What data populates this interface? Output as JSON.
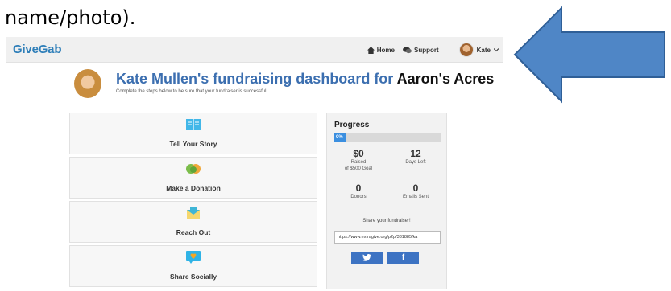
{
  "caption": "name/photo).",
  "navbar": {
    "brand": "GiveGab",
    "links": [
      {
        "label": "Home",
        "icon": "home-icon"
      },
      {
        "label": "Support",
        "icon": "chat-icon"
      }
    ],
    "user": {
      "name": "Kate",
      "icon": "chevron-down-icon"
    }
  },
  "dashboard": {
    "title_prefix": "Kate Mullen's fundraising dashboard for",
    "org_name": "Aaron's Acres",
    "subtitle": "Complete the steps below to be sure that your fundraiser is successful."
  },
  "steps": [
    {
      "label": "Tell Your Story",
      "icon": "book-icon"
    },
    {
      "label": "Make a Donation",
      "icon": "donation-icon"
    },
    {
      "label": "Reach Out",
      "icon": "envelope-icon"
    },
    {
      "label": "Share Socially",
      "icon": "heart-speech-icon"
    }
  ],
  "progress": {
    "title": "Progress",
    "percent_label": "0%",
    "percent_value": 0,
    "stats": [
      {
        "value": "$0",
        "label": "Raised",
        "label2": "of $500 Goal"
      },
      {
        "value": "12",
        "label": "Days Left"
      },
      {
        "value": "0",
        "label": "Donors"
      },
      {
        "value": "0",
        "label": "Emails Sent"
      }
    ],
    "share_label": "Share your fundraiser!",
    "share_url": "https://www.extragive.org/p2p/331885/ka",
    "twitter_label": "v",
    "facebook_label": "f"
  },
  "colors": {
    "brand": "#2f7fb9",
    "title": "#3c6fb0",
    "progress_fill": "#3b8fe0",
    "social": "#3d73c3",
    "arrow": "#4f86c6"
  }
}
